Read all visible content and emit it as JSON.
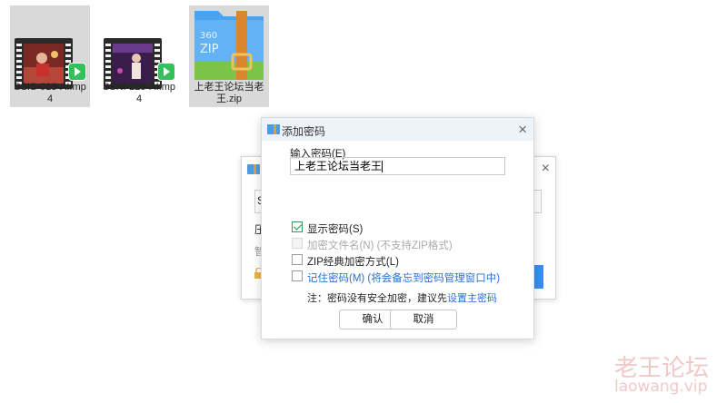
{
  "files": [
    {
      "name": "SSIS-013-AI.mp4",
      "selected": true
    },
    {
      "name": "SSNI-229-AI.mp4",
      "selected": false
    },
    {
      "name": "上老王论坛当老王.zip",
      "selected": true,
      "zip_text": "360\nZIP"
    }
  ],
  "background_dialog": {
    "field_value": "S",
    "label1": "压",
    "label2": "智",
    "close_icon": "×"
  },
  "dialog": {
    "title": "添加密码",
    "close_icon": "×",
    "password_label": "输入密码(E)",
    "password_value": "上老王论坛当老王",
    "options": [
      {
        "label": "显示密码(S)",
        "checked": true,
        "disabled": false
      },
      {
        "label": "加密文件名(N) (不支持ZIP格式)",
        "checked": false,
        "disabled": true
      },
      {
        "label": "ZIP经典加密方式(L)",
        "checked": false,
        "disabled": false
      },
      {
        "label": "记住密码(M) (将会备忘到密码管理窗口中)",
        "checked": false,
        "disabled": false
      }
    ],
    "note_prefix": "注：密码没有安全加密，建议先",
    "note_link": "设置主密码",
    "ok_label": "确认",
    "cancel_label": "取消"
  },
  "watermark": {
    "line1": "老王论坛",
    "line2": "laowang.vip"
  },
  "colors": {
    "accent": "#2b6fd6",
    "checkbox_check": "#2e8b4e",
    "titlebar": "#eef3fa",
    "zip_blue": "#4aa3f0",
    "zip_band": "#d8872c"
  }
}
